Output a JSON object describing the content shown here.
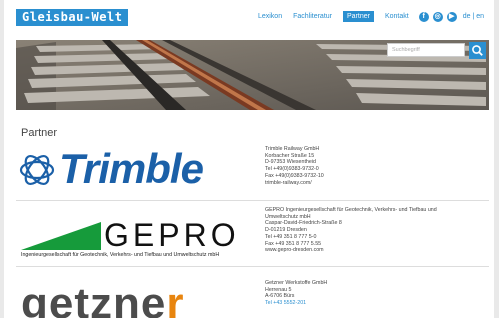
{
  "header": {
    "logo_text": "Gleisbau-Welt",
    "nav": [
      {
        "label": "Lexikon",
        "active": false
      },
      {
        "label": "Fachliteratur",
        "active": false
      },
      {
        "label": "Partner",
        "active": true
      },
      {
        "label": "Kontakt",
        "active": false
      }
    ],
    "social": [
      {
        "icon": "facebook-icon",
        "glyph": "f"
      },
      {
        "icon": "instagram-icon",
        "glyph": "◎"
      },
      {
        "icon": "youtube-icon",
        "glyph": "▶"
      }
    ],
    "language": "de | en"
  },
  "search": {
    "placeholder": "Suchbegriff"
  },
  "page": {
    "heading": "Partner"
  },
  "partners": [
    {
      "logo_text": "Trimble",
      "lines": [
        "Trimble Railway GmbH",
        "Korbacher Straße 15",
        "D-97353 Wiesentheid",
        "Tel +49(0)9383-9732-0",
        "Fax +49(0)9383-9732-10",
        "trimble-railway.com/"
      ]
    },
    {
      "logo_text": "GEPRO",
      "logo_subtitle": "Ingenieurgesellschaft für Geotechnik, Verkehrs- und Tiefbau und Umweltschutz mbH",
      "lines": [
        "GEPRO Ingenieurgesellschaft für Geotechnik, Verkehrs- und Tiefbau und",
        "Umweltschutz mbH",
        "Caspar-David-Friedrich-Straße 8",
        "D-01219 Dresden",
        "Tel +49 351 8 777 5-0",
        "Fax +49 351 8 777 5.55",
        "www.gepro-dresden.com"
      ]
    },
    {
      "logo_text_a": "getzne",
      "logo_text_b": "r",
      "lines": [
        "Getzner Werkstoffe GmbH",
        "Herrenau 5",
        "A-6706 Bürs",
        "Tel +43 5552-201"
      ]
    }
  ],
  "colors": {
    "accent": "#2a8fd0",
    "trimble_blue": "#1b60a8",
    "gepro_green": "#169b3b",
    "getzner_orange": "#e8850f"
  }
}
